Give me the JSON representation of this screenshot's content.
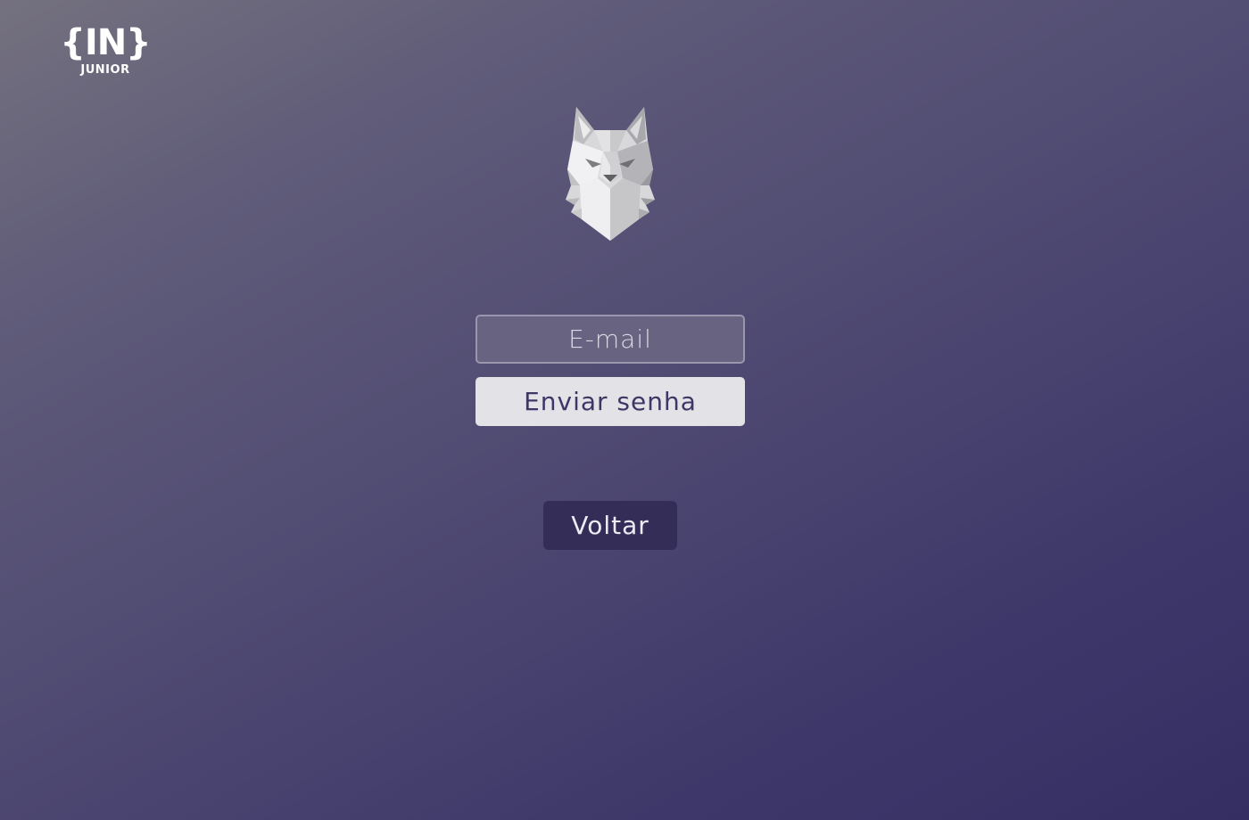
{
  "brand": {
    "mark": "{IN}",
    "sub": "JUNIOR",
    "logo_icon": "injunior-logo"
  },
  "mascot": {
    "icon": "wolf-head-icon"
  },
  "form": {
    "email_placeholder": "E-mail",
    "email_value": "",
    "submit_label": "Enviar senha"
  },
  "navigation": {
    "back_label": "Voltar"
  },
  "colors": {
    "background_top_left": "#74717f",
    "background_bottom_right": "#342e63",
    "input_background": "#686380",
    "submit_background": "#e3e2e7",
    "submit_text": "#3d3766",
    "back_background": "#332d58"
  }
}
